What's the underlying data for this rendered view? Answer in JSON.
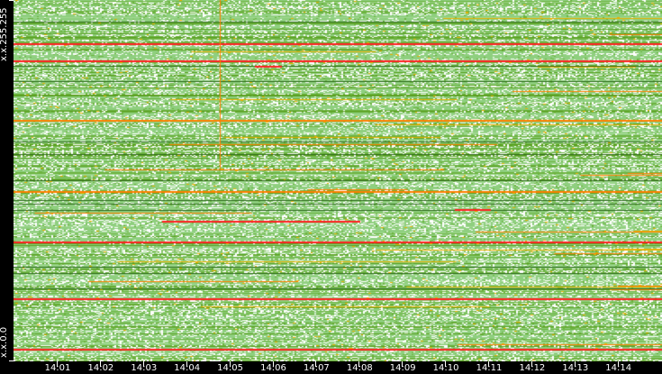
{
  "chart_data": {
    "type": "heatmap",
    "title": "",
    "xlabel": "",
    "ylabel": "",
    "y_labels": {
      "top": "x.x.255.255",
      "bottom": "x.x.0.0"
    },
    "x_ticks": [
      "14:01",
      "14:02",
      "14:03",
      "14:04",
      "14:05",
      "14:06",
      "14:07",
      "14:08",
      "14:09",
      "14:10",
      "14:11",
      "14:12",
      "14:13",
      "14:14"
    ],
    "x_range_minutes": [
      14.0,
      15.0
    ],
    "rows": 400,
    "colors": {
      "empty": "#ffffff",
      "low": "#8fcf7f",
      "mid": "#6db33f",
      "high": "#5aa020",
      "warn": "#e8b000",
      "alert": "#ff8000",
      "critical": "#ff2020",
      "background": "#000000"
    },
    "highlight_rows": [
      {
        "row": 48,
        "level": "critical"
      },
      {
        "row": 67,
        "level": "critical"
      },
      {
        "row": 133,
        "level": "alert"
      },
      {
        "row": 212,
        "level": "alert"
      },
      {
        "row": 268,
        "level": "critical"
      },
      {
        "row": 331,
        "level": "critical"
      },
      {
        "row": 387,
        "level": "critical"
      }
    ],
    "highlight_time": {
      "time": "14:04.8",
      "row_range": [
        0,
        187
      ],
      "level": "alert"
    }
  }
}
